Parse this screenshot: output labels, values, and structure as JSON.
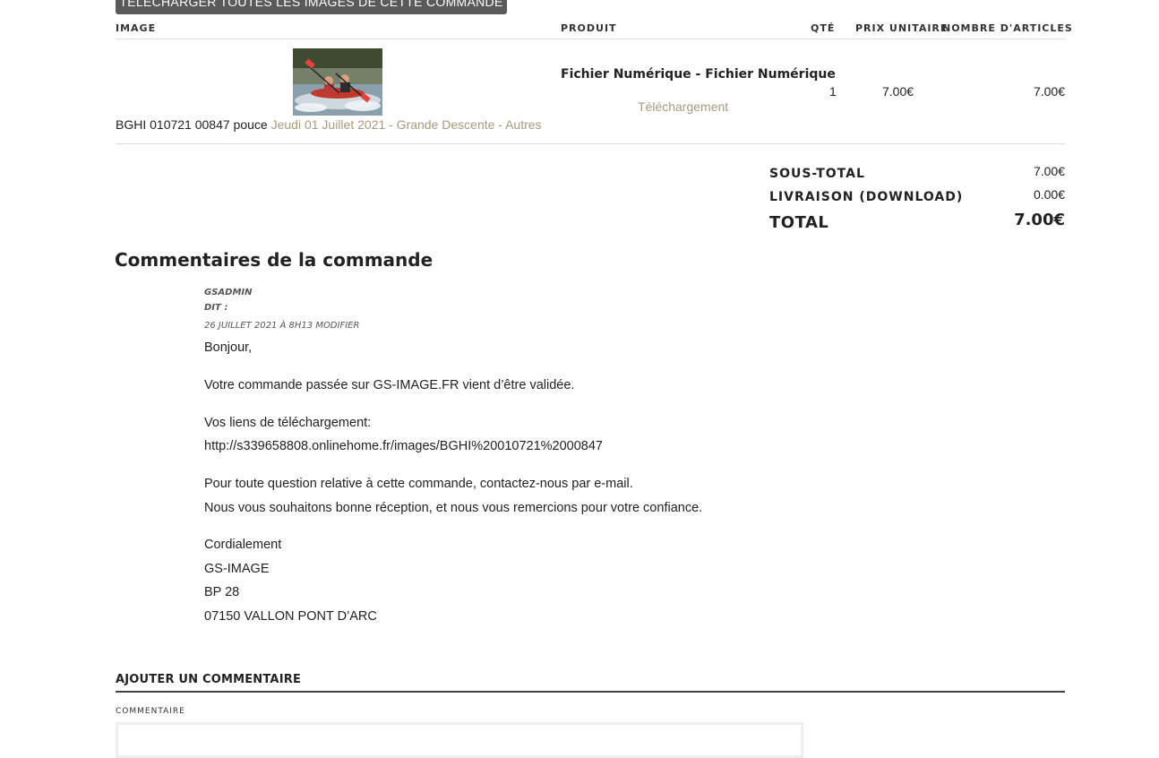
{
  "top_button": {
    "label": "TÉLÉCHARGER TOUTES LES IMAGES DE CETTE COMMANDE"
  },
  "table": {
    "headers": {
      "image": "IMAGE",
      "product": "PRODUIT",
      "qty": "QTÉ",
      "unit_price": "PRIX UNITAIRE",
      "items": "NOMBRE D'ARTICLES"
    },
    "row": {
      "image_ref": "BGHI 010721 00847 pouce",
      "image_event_link": "Jeudi 01 Juillet 2021 - Grande Descente - Autres",
      "product_title": "Fichier Numérique - Fichier Numérique",
      "product_link": "Téléchargement",
      "qty": "1",
      "unit_price": "7.00€",
      "total": "7.00€"
    }
  },
  "totals": {
    "subtotal_label": "SOUS-TOTAL",
    "subtotal_value": "7.00€",
    "shipping_label": "LIVRAISON (DOWNLOAD)",
    "shipping_value": "0.00€",
    "total_label": "TOTAL",
    "total_value": "7.00€"
  },
  "comments": {
    "section_title": "Commentaires de la commande",
    "author": "GSADMIN",
    "says": "DIT :",
    "date": "26 JUILLET 2021 À 8H13",
    "edit_link": "MODIFIER",
    "lines": {
      "greeting": "Bonjour,",
      "validated": "Votre commande passée sur GS-IMAGE.FR vient d’être validée.",
      "links_label": "Vos liens de téléchargement:",
      "download_url": "http://s339658808.onlinehome.fr/images/BGHI%20010721%2000847",
      "question": "Pour toute question relative à cette commande, contactez-nous par e-mail.",
      "thanks": "Nous vous souhaitons bonne réception, et nous vous remercions pour votre confiance.",
      "regards": "Cordialement",
      "company": "GS-IMAGE",
      "po_box": "BP 28",
      "city": "07150 VALLON PONT D’ARC"
    }
  },
  "add_comment": {
    "title": "AJOUTER UN COMMENTAIRE",
    "field_label": "COMMENTAIRE",
    "field_value": ""
  },
  "colors": {
    "link": "#a99a7e",
    "button_bg": "#5a5a5a"
  }
}
